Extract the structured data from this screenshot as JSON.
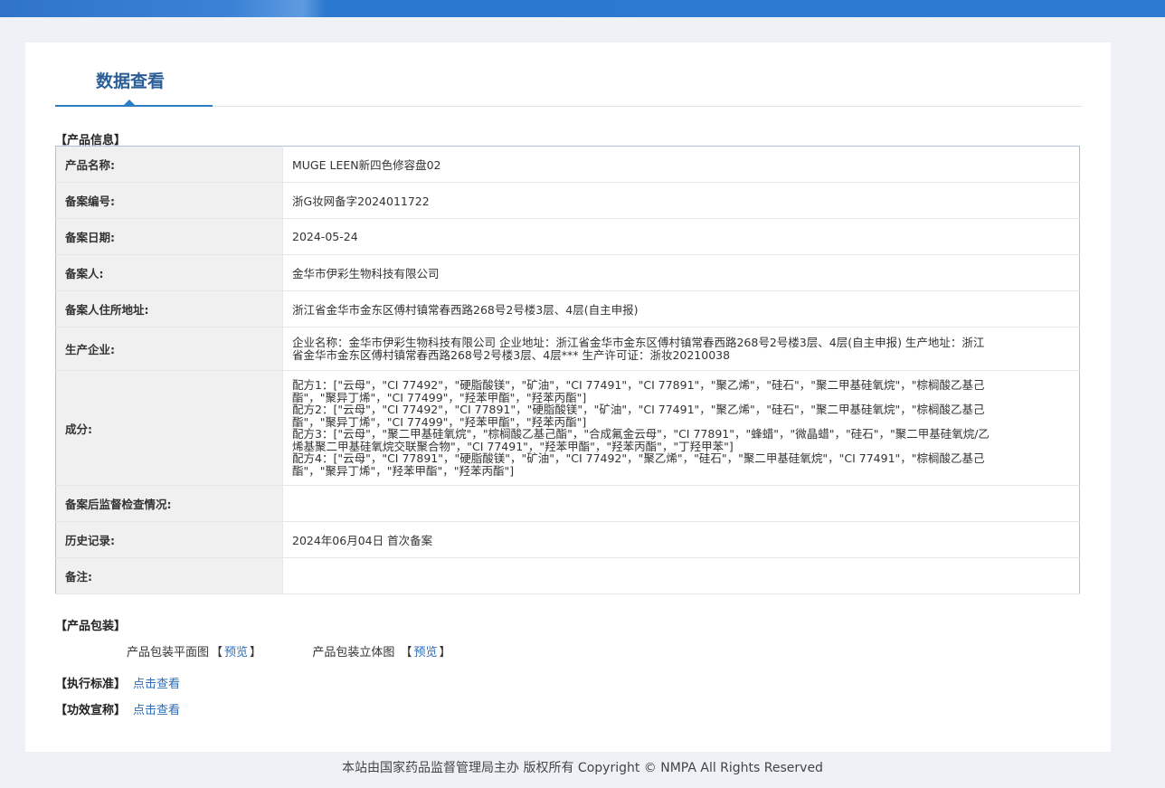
{
  "tab": {
    "title": "数据查看"
  },
  "sections": {
    "product_info": "【产品信息】",
    "packaging": "【产品包装】",
    "standard": "【执行标准】",
    "efficacy": "【功效宣称】"
  },
  "product": {
    "rows": [
      {
        "key": "产品名称:",
        "value": "MUGE LEEN新四色修容盘02"
      },
      {
        "key": "备案编号:",
        "value": "浙G妆网备字2024011722"
      },
      {
        "key": "备案日期:",
        "value": "2024-05-24"
      },
      {
        "key": "备案人:",
        "value": "金华市伊彩生物科技有限公司"
      },
      {
        "key": "备案人住所地址:",
        "value": "浙江省金华市金东区傅村镇常春西路268号2号楼3层、4层(自主申报)"
      },
      {
        "key": "生产企业:",
        "value_lines": [
          "企业名称：金华市伊彩生物科技有限公司 企业地址：浙江省金华市金东区傅村镇常春西路268号2号楼3层、4层(自主申报) 生产地址：浙江",
          "省金华市金东区傅村镇常春西路268号2号楼3层、4层*** 生产许可证：浙妆20210038"
        ]
      },
      {
        "key": "成分:",
        "value_lines": [
          "配方1：[\"云母\"，\"CI 77492\"，\"硬脂酸镁\"，\"矿油\"，\"CI 77491\"，\"CI 77891\"，\"聚乙烯\"，\"硅石\"，\"聚二甲基硅氧烷\"，\"棕榈酸乙基己",
          "酯\"，\"聚异丁烯\"，\"CI 77499\"，\"羟苯甲酯\"，\"羟苯丙酯\"]",
          "配方2：[\"云母\"，\"CI 77492\"，\"CI 77891\"，\"硬脂酸镁\"，\"矿油\"，\"CI 77491\"，\"聚乙烯\"，\"硅石\"，\"聚二甲基硅氧烷\"，\"棕榈酸乙基己",
          "酯\"，\"聚异丁烯\"，\"CI 77499\"，\"羟苯甲酯\"，\"羟苯丙酯\"]",
          "配方3：[\"云母\"，\"聚二甲基硅氧烷\"，\"棕榈酸乙基己酯\"，\"合成氟金云母\"，\"CI 77891\"，\"蜂蜡\"，\"微晶蜡\"，\"硅石\"，\"聚二甲基硅氧烷/乙",
          "烯基聚二甲基硅氧烷交联聚合物\"，\"CI 77491\"，\"羟苯甲酯\"，\"羟苯丙酯\"，\"丁羟甲苯\"]",
          "配方4：[\"云母\"，\"CI 77891\"，\"硬脂酸镁\"，\"矿油\"，\"CI 77492\"，\"聚乙烯\"，\"硅石\"，\"聚二甲基硅氧烷\"，\"CI 77491\"，\"棕榈酸乙基己",
          "酯\"，\"聚异丁烯\"，\"羟苯甲酯\"，\"羟苯丙酯\"]"
        ]
      },
      {
        "key": "备案后监督检查情况:",
        "value": ""
      },
      {
        "key": "历史记录:",
        "value": "2024年06月04日 首次备案"
      },
      {
        "key": "备注:",
        "value": ""
      }
    ]
  },
  "packaging": {
    "flat_label": "产品包装平面图",
    "flat_open": "【",
    "flat_link": "预览",
    "flat_close": "】",
    "solid_label": "产品包装立体图 ",
    "solid_open": "【",
    "solid_link": "预览",
    "solid_close": "】"
  },
  "links": {
    "standard": "点击查看",
    "efficacy": "点击查看"
  },
  "footer": "本站由国家药品监督管理局主办 版权所有 Copyright © NMPA All Rights Reserved"
}
